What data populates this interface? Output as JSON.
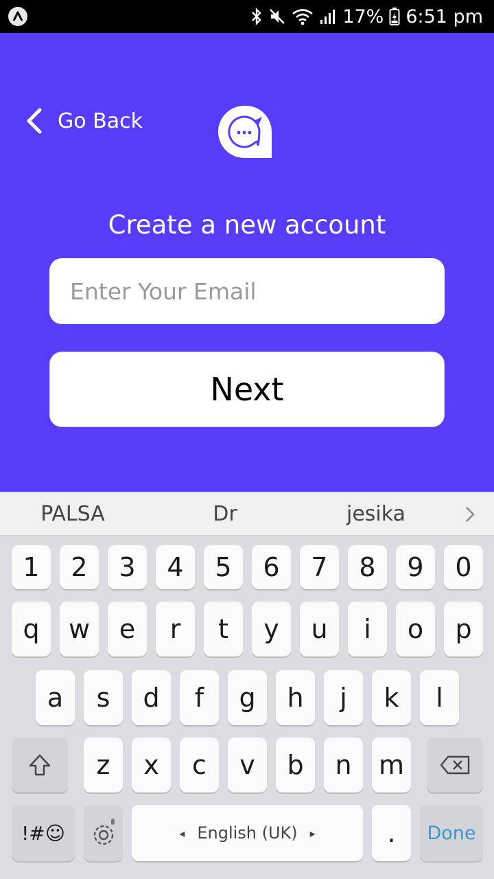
{
  "status_bar": {
    "battery": "17%",
    "time": "6:51 pm"
  },
  "header": {
    "back_label": "Go Back"
  },
  "main": {
    "title": "Create a new account",
    "email_placeholder": "Enter Your Email",
    "email_value": "",
    "next_label": "Next"
  },
  "keyboard": {
    "suggestions": [
      "PALSA",
      "Dr",
      "jesika"
    ],
    "number_row": [
      "1",
      "2",
      "3",
      "4",
      "5",
      "6",
      "7",
      "8",
      "9",
      "0"
    ],
    "row1": [
      "q",
      "w",
      "e",
      "r",
      "t",
      "y",
      "u",
      "i",
      "o",
      "p"
    ],
    "row2": [
      "a",
      "s",
      "d",
      "f",
      "g",
      "h",
      "j",
      "k",
      "l"
    ],
    "row3": [
      "z",
      "x",
      "c",
      "v",
      "b",
      "n",
      "m"
    ],
    "symbols_label": "!#☺",
    "language_label": "English (UK)",
    "period_label": ".",
    "done_label": "Done"
  },
  "colors": {
    "brand": "#573cfa",
    "done": "#3b97c9"
  }
}
